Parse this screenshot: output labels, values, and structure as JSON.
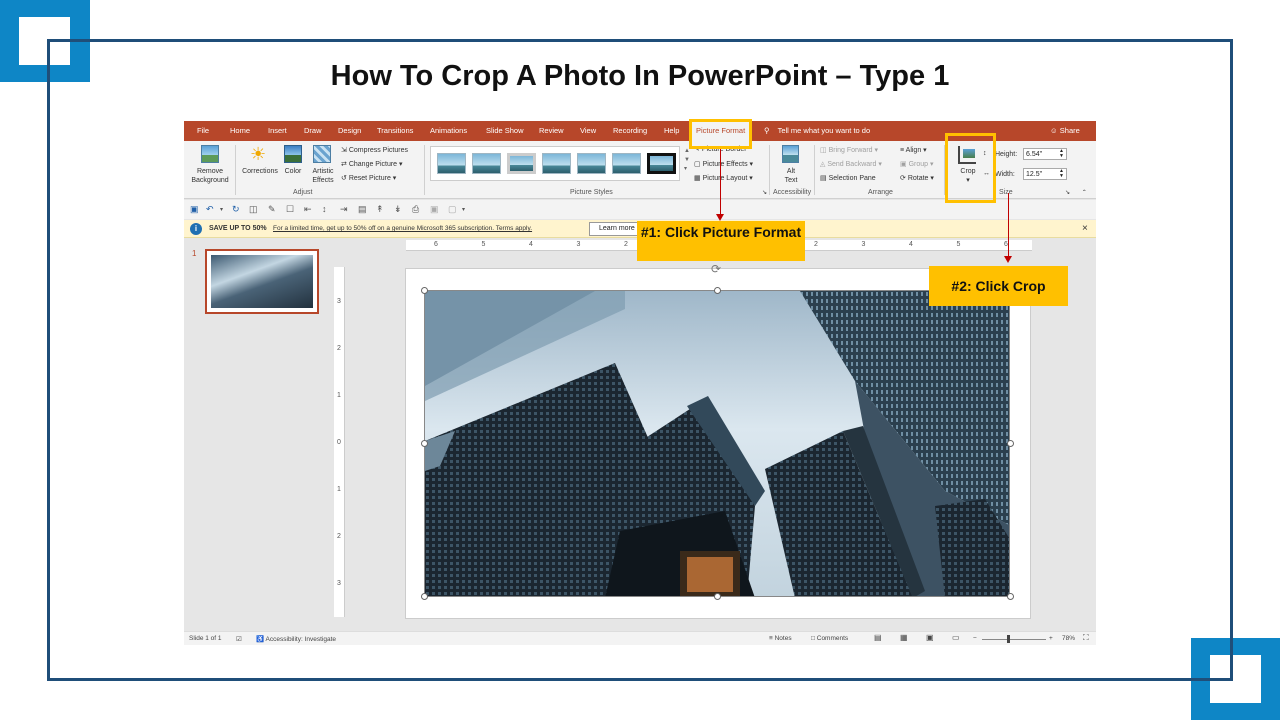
{
  "slide_title": "How To Crop A Photo In PowerPoint – Type 1",
  "tabs": {
    "file": "File",
    "items": [
      "Home",
      "Insert",
      "Draw",
      "Design",
      "Transitions",
      "Animations",
      "Slide Show",
      "Review",
      "View",
      "Recording",
      "Help"
    ],
    "active": "Picture Format",
    "tell_me": "Tell me what you want to do",
    "share": "Share"
  },
  "ribbon": {
    "remove_background": [
      "Remove",
      "Background"
    ],
    "corrections": "Corrections",
    "color": "Color",
    "artistic_effects": [
      "Artistic",
      "Effects"
    ],
    "compress_pictures": "Compress Pictures",
    "change_picture": "Change Picture",
    "reset_picture": "Reset Picture",
    "adjust_label": "Adjust",
    "picture_border": "Picture Border",
    "picture_effects": "Picture Effects",
    "picture_layout": "Picture Layout",
    "picture_styles_label": "Picture Styles",
    "alt_text": [
      "Alt",
      "Text"
    ],
    "accessibility_label": "Accessibility",
    "bring_forward": "Bring Forward",
    "send_backward": "Send Backward",
    "selection_pane": "Selection Pane",
    "align": "Align",
    "group": "Group",
    "rotate": "Rotate",
    "arrange_label": "Arrange",
    "crop": "Crop",
    "height_label": "Height:",
    "height_value": "6.54\"",
    "width_label": "Width:",
    "width_value": "12.5\"",
    "size_label": "Size"
  },
  "message_bar": {
    "title": "SAVE UP TO 50%",
    "text": "For a limited time, get up to 50% off on a genuine Microsoft 365 subscription. Terms apply.",
    "button": "Learn more",
    "close": "×"
  },
  "slide_panel": {
    "number": "1"
  },
  "rulers": {
    "horizontal": [
      "6",
      "5",
      "4",
      "3",
      "2",
      "1",
      "0",
      "1",
      "2",
      "3",
      "4",
      "5",
      "6"
    ],
    "vertical": [
      "3",
      "2",
      "1",
      "0",
      "1",
      "2",
      "3"
    ]
  },
  "status": {
    "slide": "Slide 1 of 1",
    "accessibility": "Accessibility: Investigate",
    "notes": "Notes",
    "comments": "Comments",
    "zoom_minus": "−",
    "zoom_plus": "+",
    "zoom": "78%"
  },
  "callouts": {
    "step1": "#1: Click Picture Format",
    "step2": "#2: Click Crop"
  },
  "colors": {
    "accent_blue": "#0e86c6",
    "frame_blue": "#1f4e79",
    "ribbon_red": "#b7472a",
    "callout_yellow": "#ffc000",
    "arrow_red": "#c00000"
  }
}
